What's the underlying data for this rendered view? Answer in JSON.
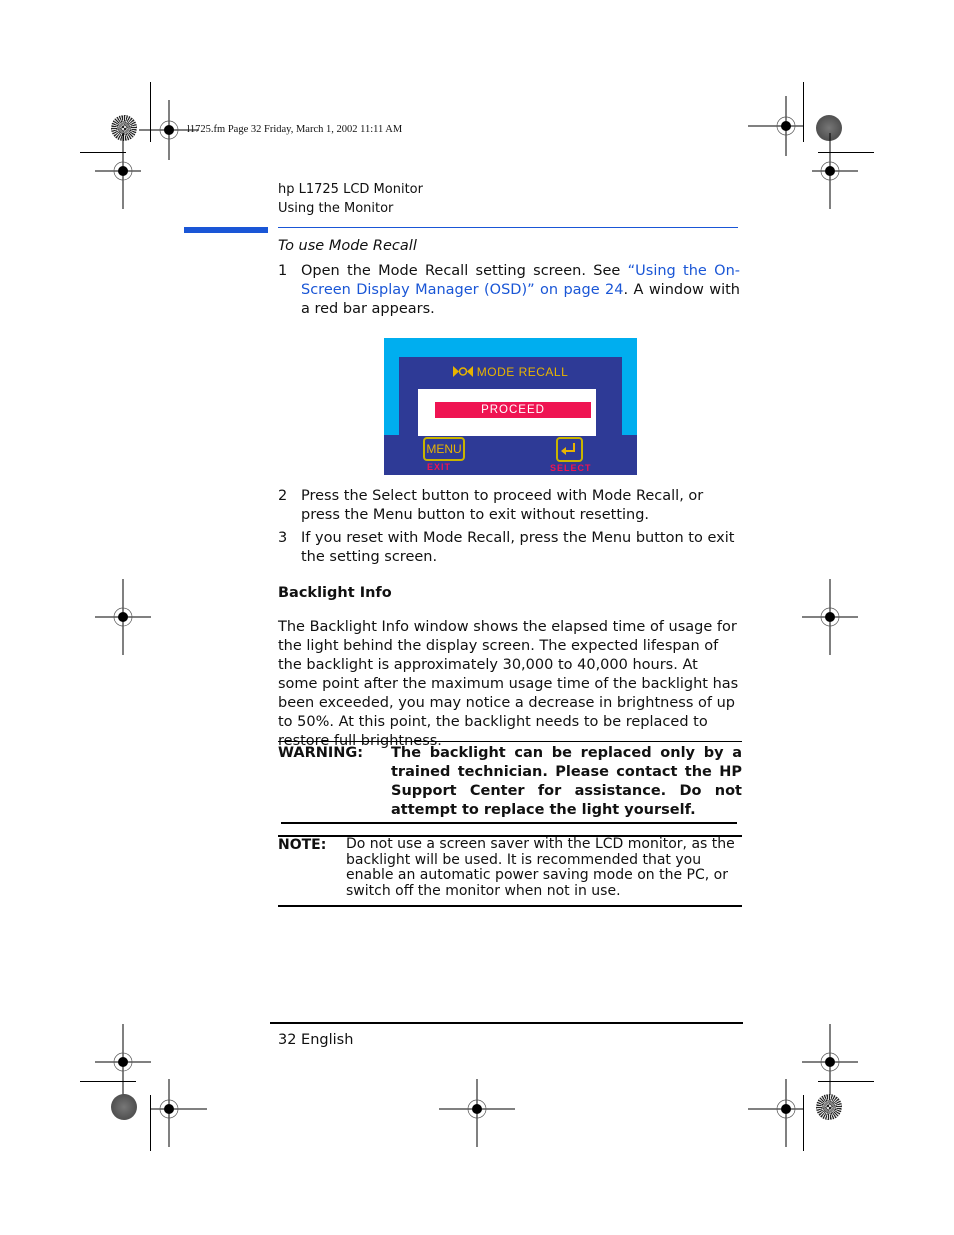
{
  "slug": "l1725.fm  Page 32  Friday, March 1, 2002  11:11 AM",
  "header": {
    "title": "hp L1725 LCD Monitor",
    "subtitle": "Using the Monitor",
    "accent_color": "#1a56d6"
  },
  "section1": {
    "heading": "To use Mode Recall",
    "steps": [
      {
        "num": "1",
        "before": "Open the Mode Recall setting screen. See ",
        "link": "“Using the On-Screen Display Manager (OSD)” on page 24",
        "after": ". A window with a red bar appears."
      },
      {
        "num": "2",
        "text": "Press the Select button to proceed with Mode Recall, or press the Menu button to exit without resetting."
      },
      {
        "num": "3",
        "text": "If you reset with Mode Recall, press the Menu button to exit the setting screen."
      }
    ]
  },
  "osd": {
    "title": "MODE RECALL",
    "bar_label": "PROCEED",
    "menu_button": "MENU",
    "menu_caption": "EXIT",
    "select_caption": "SELECT",
    "colors": {
      "outer": "#00aeef",
      "panel": "#2e3a96",
      "bar": "#ef1452",
      "gold": "#e8b400"
    }
  },
  "section2": {
    "heading": "Backlight Info",
    "paragraph": "The Backlight Info window shows the elapsed time of usage for the light behind the display screen. The expected lifespan of the backlight is approximately 30,000 to 40,000 hours. At some point after the maximum usage time of the backlight has been exceeded, you may notice a decrease in brightness of up to 50%. At this point, the backlight needs to be replaced to restore full brightness."
  },
  "warning": {
    "label": "WARNING:",
    "text": "The backlight can be replaced only by a trained technician. Please contact the HP Support Center for assistance. Do not attempt to replace the light yourself."
  },
  "note": {
    "label": "NOTE:",
    "text": "Do not use a screen saver with the LCD monitor, as the backlight will be used. It is recommended that you enable an automatic power saving mode on the PC, or switch off the monitor when not in use."
  },
  "footer": {
    "page": "32 English"
  }
}
